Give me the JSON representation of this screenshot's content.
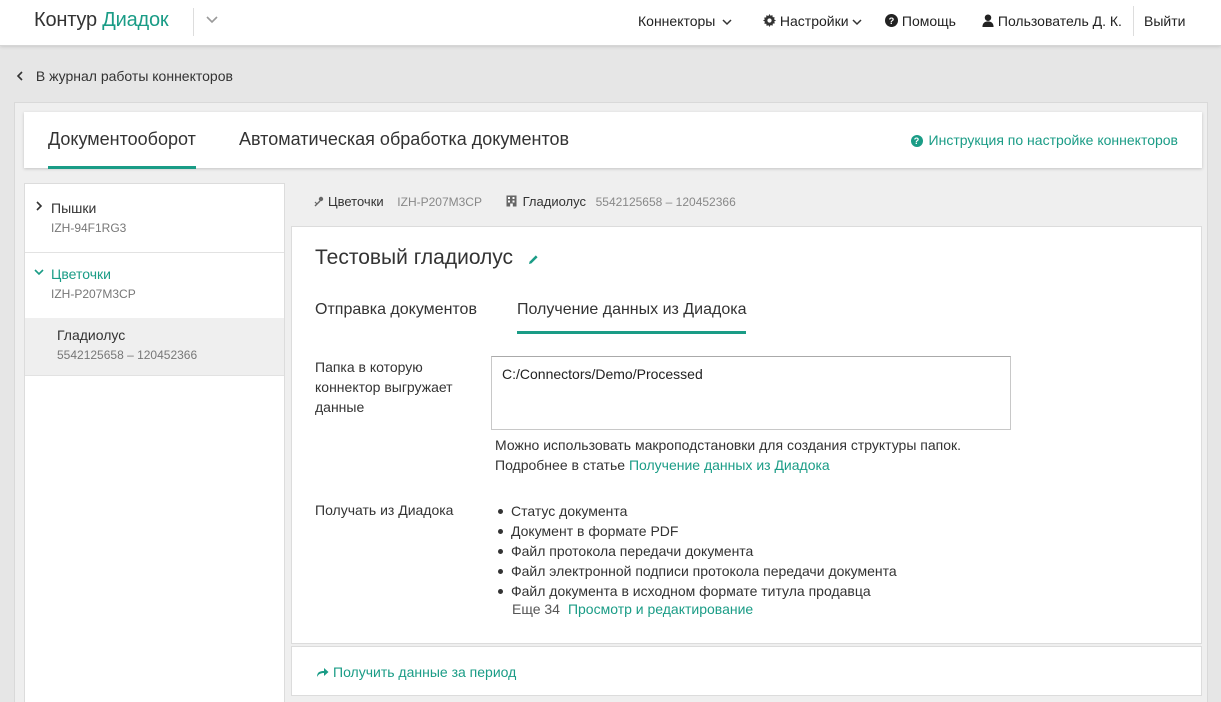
{
  "header": {
    "logo_part1": "Контур",
    "logo_part2": "Диадок",
    "nav": {
      "connectors": "Коннекторы",
      "settings": "Настройки",
      "help": "Помощь",
      "user": "Пользователь Д. К.",
      "logout": "Выйти"
    }
  },
  "back_link": "В журнал работы коннекторов",
  "top_tabs": {
    "tab1": "Документооборот",
    "tab2": "Автоматическая обработка документов",
    "help_link": "Инструкция по настройке коннекторов"
  },
  "sidebar": {
    "items": [
      {
        "name": "Пышки",
        "sub": "IZH-94F1RG3"
      },
      {
        "name": "Цветочки",
        "sub": "IZH-P207M3CP"
      },
      {
        "name": "Гладиолус",
        "sub": "5542125658 – 120452366"
      }
    ]
  },
  "breadcrumb": {
    "org_name": "Цветочки",
    "org_code": "IZH-P207M3CP",
    "box_name": "Гладиолус",
    "box_code": "5542125658 – 120452366"
  },
  "main": {
    "title": "Тестовый гладиолус",
    "subtabs": {
      "send": "Отправка документов",
      "receive": "Получение данных из Диадока"
    },
    "folder_label": "Папка в которую коннектор выгружает данные",
    "folder_value": "C:/Connectors/Demo/Processed",
    "hint_line1": "Можно использовать макроподстановки для создания структуры папок.",
    "hint_line2_prefix": "Подробнее в статье",
    "hint_link": "Получение данных из Диадока",
    "receive_label": "Получать из Диадока",
    "receive_items": [
      "Статус документа",
      "Документ в формате PDF",
      "Файл протокола передачи документа",
      "Файл электронной подписи протокола передачи документа",
      "Файл документа в исходном формате титула продавца"
    ],
    "more_count": "Еще 34",
    "more_link": "Просмотр и редактирование"
  },
  "action": {
    "label": "Получить данные за период"
  },
  "colors": {
    "accent": "#1a9c86",
    "page_bg": "#e6e6e6"
  }
}
